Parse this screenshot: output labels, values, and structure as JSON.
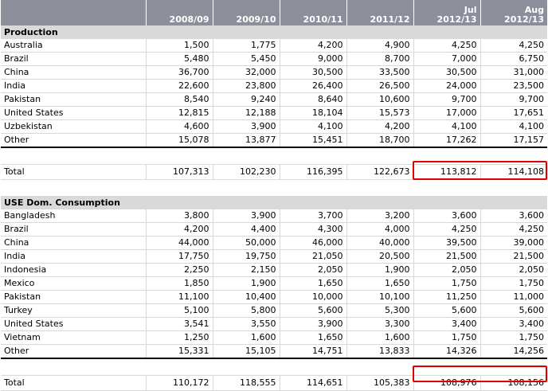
{
  "columns": [
    {
      "top": "",
      "bottom": "2008/09"
    },
    {
      "top": "",
      "bottom": "2009/10"
    },
    {
      "top": "",
      "bottom": "2010/11"
    },
    {
      "top": "",
      "bottom": "2011/12"
    },
    {
      "top": "Jul",
      "bottom": "2012/13"
    },
    {
      "top": "Aug",
      "bottom": "2012/13"
    }
  ],
  "production": {
    "title": "Production",
    "rows": [
      {
        "name": "Australia",
        "values": [
          "1,500",
          "1,775",
          "4,200",
          "4,900",
          "4,250",
          "4,250"
        ]
      },
      {
        "name": "Brazil",
        "values": [
          "5,480",
          "5,450",
          "9,000",
          "8,700",
          "7,000",
          "6,750"
        ]
      },
      {
        "name": "China",
        "values": [
          "36,700",
          "32,000",
          "30,500",
          "33,500",
          "30,500",
          "31,000"
        ]
      },
      {
        "name": "India",
        "values": [
          "22,600",
          "23,800",
          "26,400",
          "26,500",
          "24,000",
          "23,500"
        ]
      },
      {
        "name": "Pakistan",
        "values": [
          "8,540",
          "9,240",
          "8,640",
          "10,600",
          "9,700",
          "9,700"
        ]
      },
      {
        "name": "United States",
        "values": [
          "12,815",
          "12,188",
          "18,104",
          "15,573",
          "17,000",
          "17,651"
        ]
      },
      {
        "name": "Uzbekistan",
        "values": [
          "4,600",
          "3,900",
          "4,100",
          "4,200",
          "4,100",
          "4,100"
        ]
      },
      {
        "name": "Other",
        "values": [
          "15,078",
          "13,877",
          "15,451",
          "18,700",
          "17,262",
          "17,157"
        ]
      }
    ],
    "total": {
      "name": "Total",
      "values": [
        "107,313",
        "102,230",
        "116,395",
        "122,673",
        "113,812",
        "114,108"
      ]
    }
  },
  "consumption": {
    "title": "USE Dom. Consumption",
    "rows": [
      {
        "name": "Bangladesh",
        "values": [
          "3,800",
          "3,900",
          "3,700",
          "3,200",
          "3,600",
          "3,600"
        ]
      },
      {
        "name": "Brazil",
        "values": [
          "4,200",
          "4,400",
          "4,300",
          "4,000",
          "4,250",
          "4,250"
        ]
      },
      {
        "name": "China",
        "values": [
          "44,000",
          "50,000",
          "46,000",
          "40,000",
          "39,500",
          "39,000"
        ]
      },
      {
        "name": "India",
        "values": [
          "17,750",
          "19,750",
          "21,050",
          "20,500",
          "21,500",
          "21,500"
        ]
      },
      {
        "name": "Indonesia",
        "values": [
          "2,250",
          "2,150",
          "2,050",
          "1,900",
          "2,050",
          "2,050"
        ]
      },
      {
        "name": "Mexico",
        "values": [
          "1,850",
          "1,900",
          "1,650",
          "1,650",
          "1,750",
          "1,750"
        ]
      },
      {
        "name": "Pakistan",
        "values": [
          "11,100",
          "10,400",
          "10,000",
          "10,100",
          "11,250",
          "11,000"
        ]
      },
      {
        "name": "Turkey",
        "values": [
          "5,100",
          "5,800",
          "5,600",
          "5,300",
          "5,600",
          "5,600"
        ]
      },
      {
        "name": "United States",
        "values": [
          "3,541",
          "3,550",
          "3,900",
          "3,300",
          "3,400",
          "3,400"
        ]
      },
      {
        "name": "Vietnam",
        "values": [
          "1,250",
          "1,600",
          "1,650",
          "1,600",
          "1,750",
          "1,750"
        ]
      },
      {
        "name": "Other",
        "values": [
          "15,331",
          "15,105",
          "14,751",
          "13,833",
          "14,326",
          "14,256"
        ]
      }
    ],
    "total": {
      "name": "Total",
      "values": [
        "110,172",
        "118,555",
        "114,651",
        "105,383",
        "108,976",
        "108,156"
      ]
    }
  },
  "colors": {
    "header_bg": "#8c8e9a",
    "section_bg": "#d9d9d9",
    "highlight": "#e00000"
  }
}
